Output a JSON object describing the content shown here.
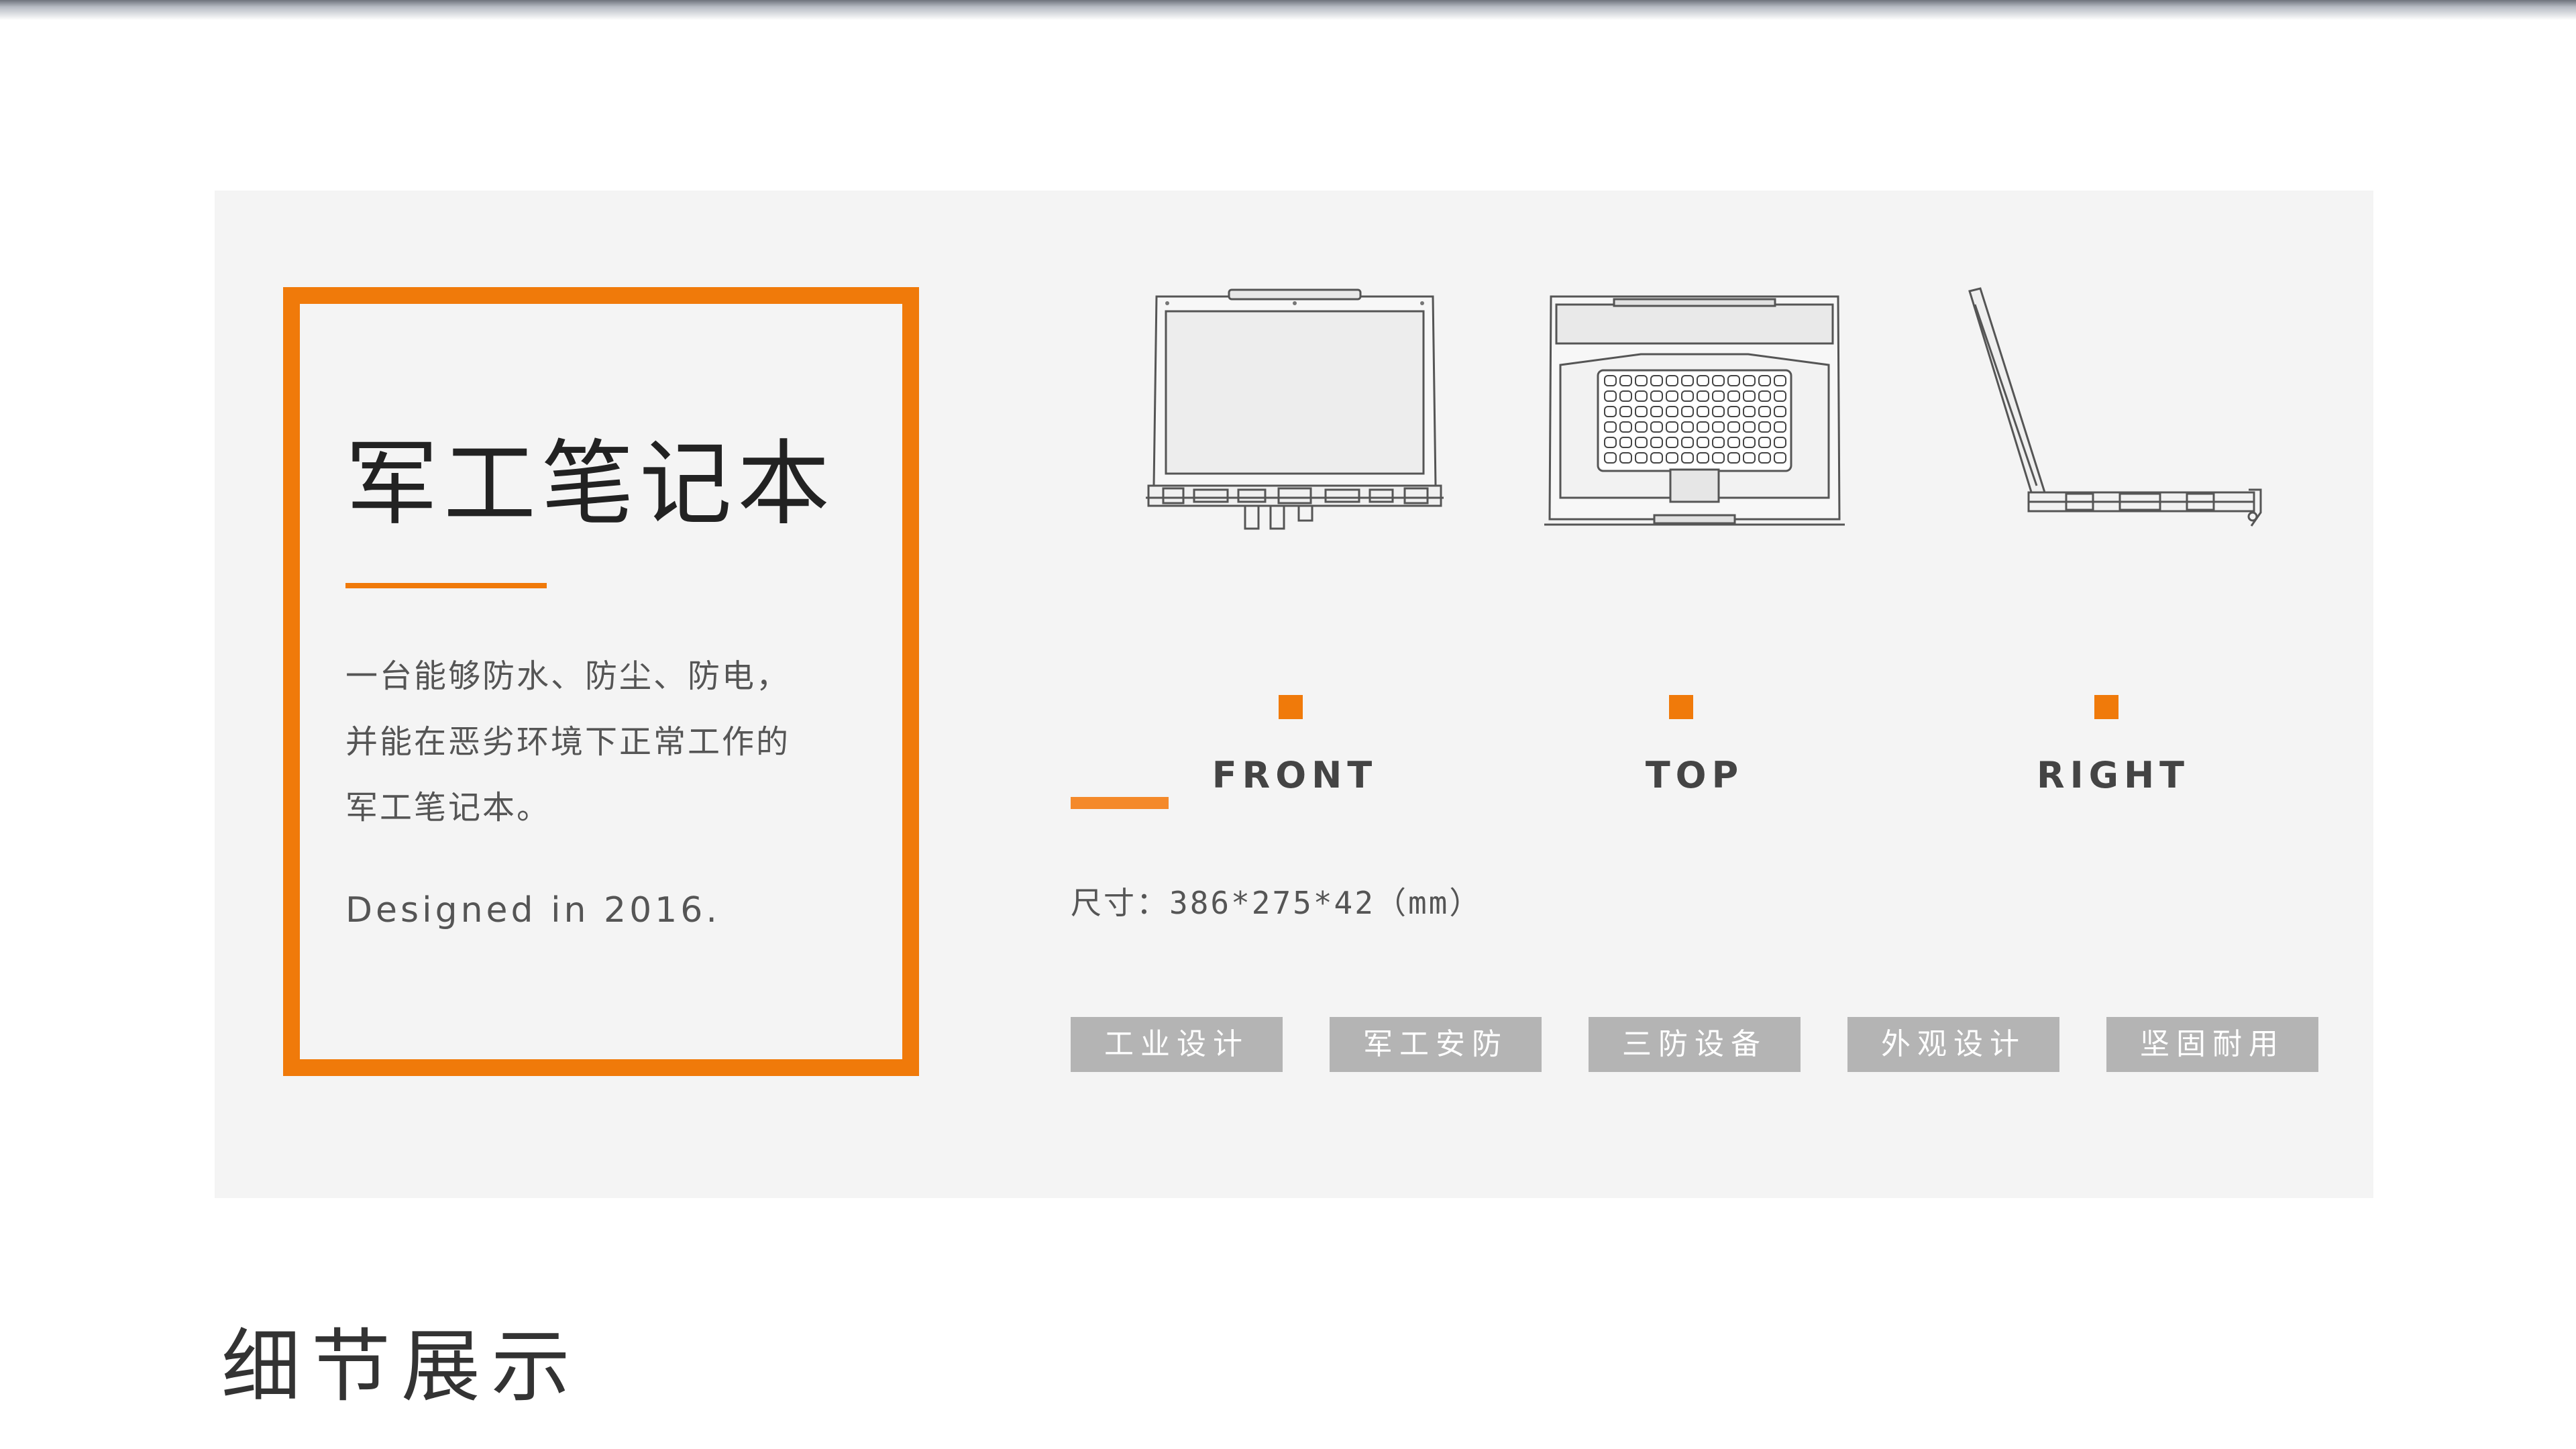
{
  "product": {
    "title": "军工笔记本",
    "description_lines": [
      "一台能够防水、防尘、防电，",
      "并能在恶劣环境下正常工作的",
      "军工笔记本。"
    ],
    "designed": "Designed in 2016."
  },
  "views": [
    {
      "label": "FRONT",
      "icon": "laptop-front-view-drawing"
    },
    {
      "label": "TOP",
      "icon": "laptop-top-view-drawing"
    },
    {
      "label": "RIGHT",
      "icon": "laptop-right-view-drawing"
    }
  ],
  "specs": {
    "size": "尺寸：386*275*42（mm）"
  },
  "tags": [
    "工业设计",
    "军工安防",
    "三防设备",
    "外观设计",
    "坚固耐用"
  ],
  "section": {
    "title": "细节展示"
  },
  "colors": {
    "accent": "#f07a0a",
    "panel": "#f4f4f4",
    "tag": "#b4b4b4"
  }
}
